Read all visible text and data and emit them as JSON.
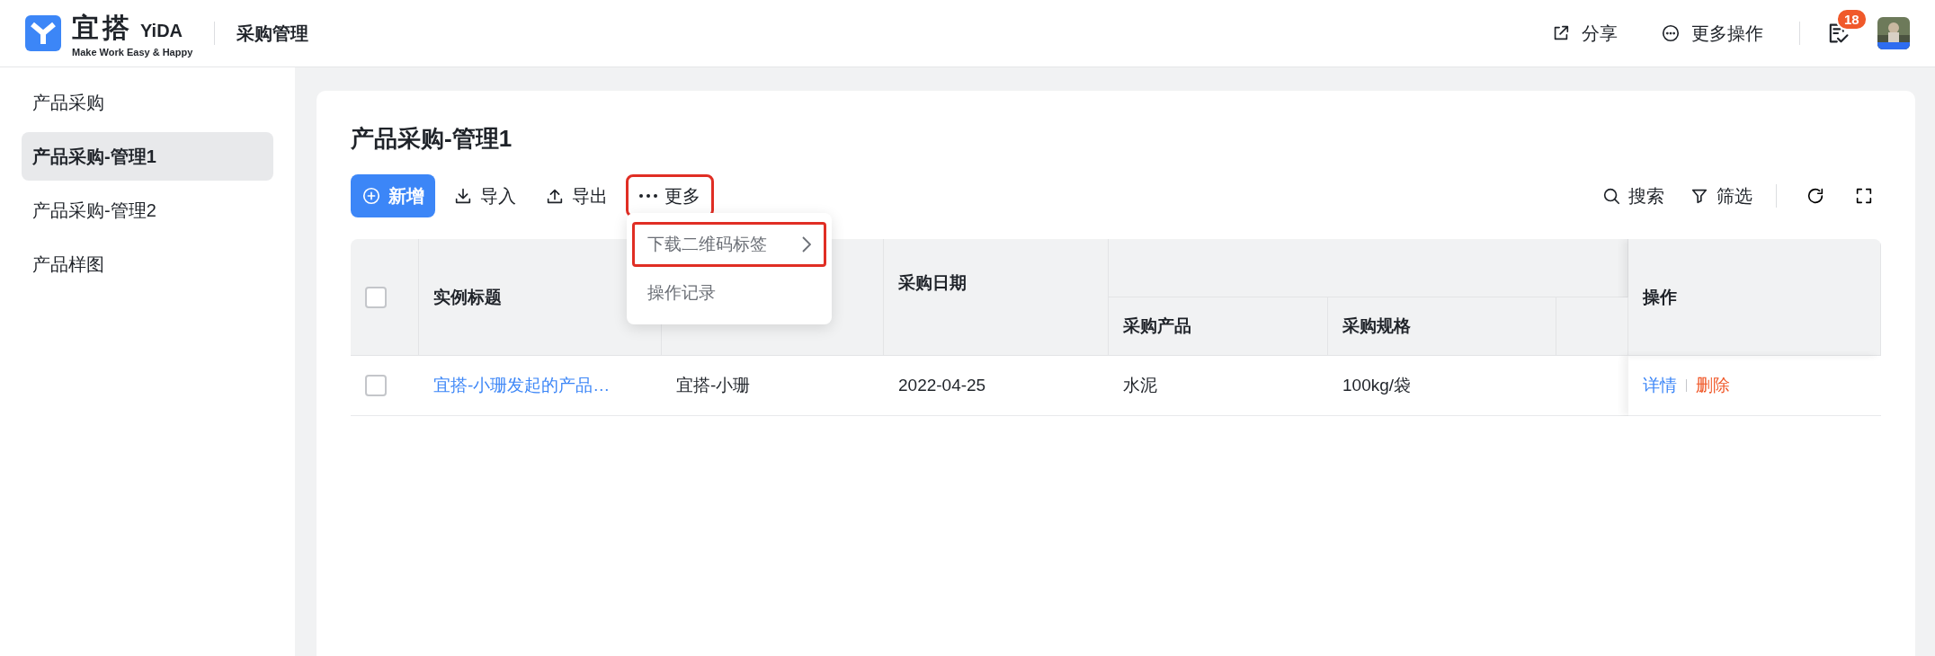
{
  "header": {
    "logo_name": "宜搭",
    "logo_brand": "YiDA",
    "logo_tagline": "Make Work Easy & Happy",
    "app_title": "采购管理",
    "actions": [
      {
        "label": "分享",
        "kind": "share"
      },
      {
        "label": "更多操作",
        "kind": "more"
      }
    ],
    "todo_badge": "18"
  },
  "sidebar": {
    "items": [
      {
        "label": "产品采购",
        "selected": false
      },
      {
        "label": "产品采购-管理1",
        "selected": true
      },
      {
        "label": "产品采购-管理2",
        "selected": false
      },
      {
        "label": "产品样图",
        "selected": false
      }
    ]
  },
  "page_title": "产品采购-管理1",
  "toolbar": {
    "buttons": [
      {
        "label": "新增",
        "kind": "primary",
        "highlighted": false
      },
      {
        "label": "导入",
        "kind": "import",
        "highlighted": false
      },
      {
        "label": "导出",
        "kind": "export",
        "highlighted": false
      },
      {
        "label": "更多",
        "kind": "more",
        "highlighted": true
      }
    ],
    "right": [
      {
        "label": "搜索",
        "kind": "search"
      },
      {
        "label": "筛选",
        "kind": "filter"
      }
    ]
  },
  "more_menu": {
    "items": [
      {
        "label": "下载二维码标签",
        "has_submenu": true,
        "highlighted": true
      },
      {
        "label": "操作记录",
        "has_submenu": false,
        "highlighted": false
      }
    ]
  },
  "table": {
    "header_checked": false,
    "columns": [
      "实例标题",
      "采购日期",
      "采购产品",
      "采购规格",
      "操作"
    ],
    "rows": [
      {
        "checked": false,
        "title": "宜搭-小珊发起的产品…",
        "column_3": "宜搭-小珊",
        "date": "2022-04-25",
        "product": "水泥",
        "spec": "100kg/袋",
        "actions": [
          "详情",
          "删除"
        ]
      }
    ]
  }
}
